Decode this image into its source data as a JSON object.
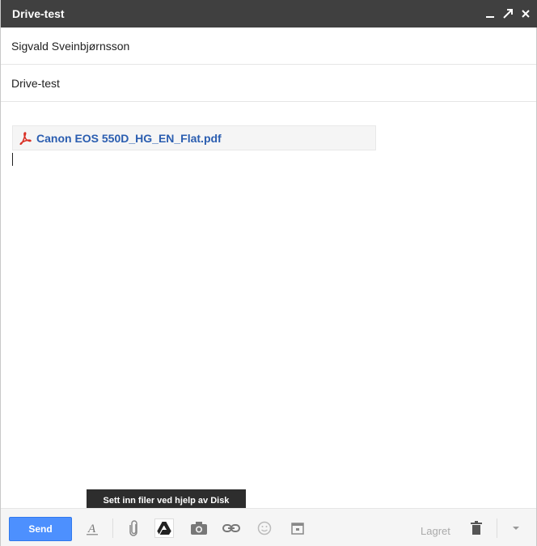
{
  "window": {
    "title": "Drive-test",
    "controls": [
      "minimize-icon",
      "popout-icon",
      "close-icon"
    ]
  },
  "fields": {
    "to": "Sigvald Sveinbjørnsson",
    "subject": "Drive-test"
  },
  "body": {
    "attachment": {
      "icon": "pdf-icon",
      "name": "Canon EOS 550D_HG_EN_Flat.pdf"
    }
  },
  "tooltip": "Sett inn filer ved hjelp av Disk",
  "toolbar": {
    "send_label": "Send",
    "saved_label": "Lagret",
    "icons": [
      "formatting-icon",
      "paperclip-icon",
      "drive-icon",
      "camera-icon",
      "link-icon",
      "emoji-icon",
      "calendar-icon",
      "trash-icon",
      "chevron-down-icon"
    ]
  },
  "colors": {
    "titlebar": "#404040",
    "send_button": "#4d90fe",
    "link": "#2a5db0",
    "pdf_red": "#d93025"
  }
}
